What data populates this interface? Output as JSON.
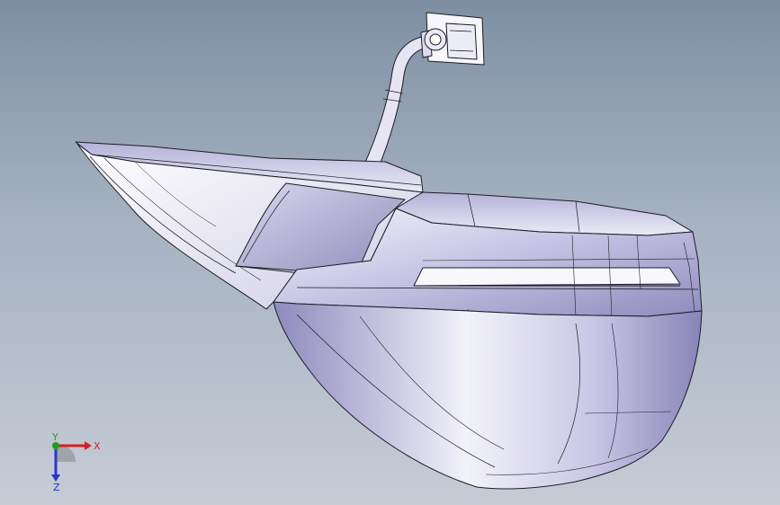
{
  "viewport": {
    "background_top": "#7f8fa3",
    "background_bottom": "#c6ccd6",
    "model_edge_color": "#1c1c24",
    "model_face_light": "#f3f3fa",
    "model_face_shade": "#9c98c4"
  },
  "triad": {
    "x_label": "X",
    "y_label": "Y",
    "z_label": "Z",
    "x_color": "#d42020",
    "y_color": "#1ea01e",
    "z_color": "#2a35c8"
  }
}
